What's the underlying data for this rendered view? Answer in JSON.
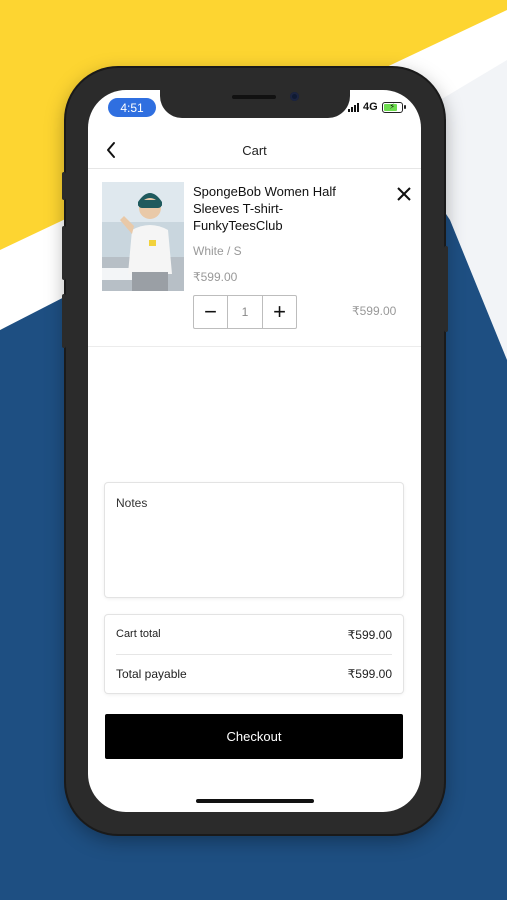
{
  "status_bar": {
    "time": "4:51",
    "network": "4G"
  },
  "header": {
    "title": "Cart"
  },
  "cart_item": {
    "name": "SpongeBob Women Half Sleeves T-shirt-FunkyTeesClub",
    "variant": "White / S",
    "unit_price": "₹599.00",
    "quantity": "1",
    "minus_label": "−",
    "plus_label": "+",
    "line_total": "₹599.00"
  },
  "notes": {
    "label": "Notes"
  },
  "totals": {
    "cart_total_label": "Cart total",
    "cart_total_value": "₹599.00",
    "payable_label": "Total payable",
    "payable_value": "₹599.00"
  },
  "checkout": {
    "label": "Checkout"
  },
  "colors": {
    "background_yellow": "#fdd531",
    "background_blue": "#1e4f82",
    "button": "#000000"
  },
  "icons": [
    "back-chevron-icon",
    "close-icon",
    "signal-icon",
    "battery-icon"
  ]
}
